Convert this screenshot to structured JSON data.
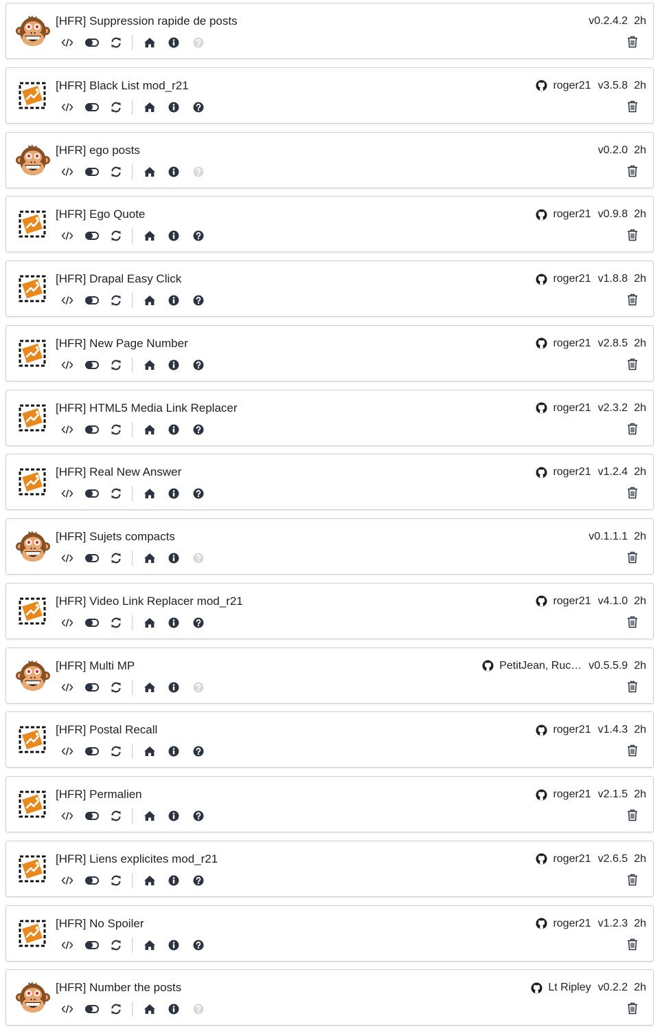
{
  "colors": {
    "icon": "#2b3440",
    "icon_disabled": "#d9d9d9",
    "border": "#cfcfcf",
    "orange": "#e8891d"
  },
  "toolbar_icons": [
    "code-icon",
    "toggle-icon",
    "sync-icon",
    "home-icon",
    "info-icon",
    "help-icon"
  ],
  "scripts": [
    {
      "title": "[HFR] Suppression rapide de posts",
      "author": "",
      "version": "v0.2.4.2",
      "age": "2h",
      "icon": "monkey",
      "help_enabled": false
    },
    {
      "title": "[HFR] Black List mod_r21",
      "author": "roger21",
      "version": "v3.5.8",
      "age": "2h",
      "icon": "placeholder",
      "help_enabled": true
    },
    {
      "title": "[HFR] ego posts",
      "author": "",
      "version": "v0.2.0",
      "age": "2h",
      "icon": "monkey",
      "help_enabled": false
    },
    {
      "title": "[HFR] Ego Quote",
      "author": "roger21",
      "version": "v0.9.8",
      "age": "2h",
      "icon": "placeholder",
      "help_enabled": true
    },
    {
      "title": "[HFR] Drapal Easy Click",
      "author": "roger21",
      "version": "v1.8.8",
      "age": "2h",
      "icon": "placeholder",
      "help_enabled": true
    },
    {
      "title": "[HFR] New Page Number",
      "author": "roger21",
      "version": "v2.8.5",
      "age": "2h",
      "icon": "placeholder",
      "help_enabled": true
    },
    {
      "title": "[HFR] HTML5 Media Link Replacer",
      "author": "roger21",
      "version": "v2.3.2",
      "age": "2h",
      "icon": "placeholder",
      "help_enabled": true
    },
    {
      "title": "[HFR] Real New Answer",
      "author": "roger21",
      "version": "v1.2.4",
      "age": "2h",
      "icon": "placeholder",
      "help_enabled": true
    },
    {
      "title": "[HFR] Sujets compacts",
      "author": "",
      "version": "v0.1.1.1",
      "age": "2h",
      "icon": "monkey",
      "help_enabled": false
    },
    {
      "title": "[HFR] Video Link Replacer mod_r21",
      "author": "roger21",
      "version": "v4.1.0",
      "age": "2h",
      "icon": "placeholder",
      "help_enabled": true
    },
    {
      "title": "[HFR] Multi MP",
      "author": "PetitJean, Ruc…",
      "version": "v0.5.5.9",
      "age": "2h",
      "icon": "monkey",
      "help_enabled": false
    },
    {
      "title": "[HFR] Postal Recall",
      "author": "roger21",
      "version": "v1.4.3",
      "age": "2h",
      "icon": "placeholder",
      "help_enabled": true
    },
    {
      "title": "[HFR] Permalien",
      "author": "roger21",
      "version": "v2.1.5",
      "age": "2h",
      "icon": "placeholder",
      "help_enabled": true
    },
    {
      "title": "[HFR] Liens explicites mod_r21",
      "author": "roger21",
      "version": "v2.6.5",
      "age": "2h",
      "icon": "placeholder",
      "help_enabled": true
    },
    {
      "title": "[HFR] No Spoiler",
      "author": "roger21",
      "version": "v1.2.3",
      "age": "2h",
      "icon": "placeholder",
      "help_enabled": true
    },
    {
      "title": "[HFR] Number the posts",
      "author": "Lt Ripley",
      "version": "v0.2.2",
      "age": "2h",
      "icon": "monkey",
      "help_enabled": false
    }
  ]
}
